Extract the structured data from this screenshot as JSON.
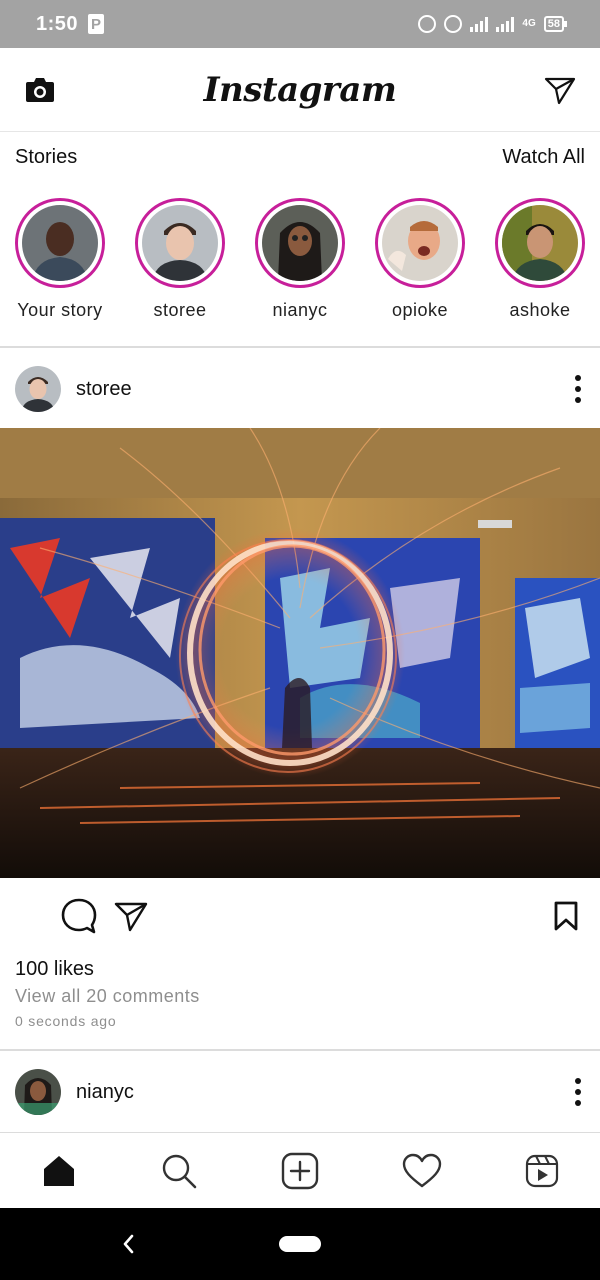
{
  "status_bar": {
    "time": "1:50",
    "p_badge": "P",
    "network": "4G",
    "battery": "58"
  },
  "app": {
    "title": "Instagram"
  },
  "stories": {
    "header": "Stories",
    "watch_all": "Watch All",
    "items": [
      {
        "label": "Your story"
      },
      {
        "label": "storee"
      },
      {
        "label": "nianyc"
      },
      {
        "label": "opioke"
      },
      {
        "label": "ashoke"
      }
    ]
  },
  "posts": [
    {
      "username": "storee",
      "likes": "100 likes",
      "comments": "View all 20 comments",
      "time": "0 seconds ago"
    },
    {
      "username": "nianyc"
    }
  ],
  "colors": {
    "story_ring": "#c71f9a",
    "status_bar": "#a3a3a3",
    "divider": "#dcdcdc",
    "muted_text": "#8e8e8e"
  },
  "icons": {
    "top_left": "camera-icon",
    "top_right": "send-icon",
    "post_actions": [
      "comment-icon",
      "share-icon",
      "bookmark-icon"
    ],
    "bottom_nav": [
      "home-icon",
      "search-icon",
      "add-post-icon",
      "heart-icon",
      "reels-icon"
    ]
  }
}
